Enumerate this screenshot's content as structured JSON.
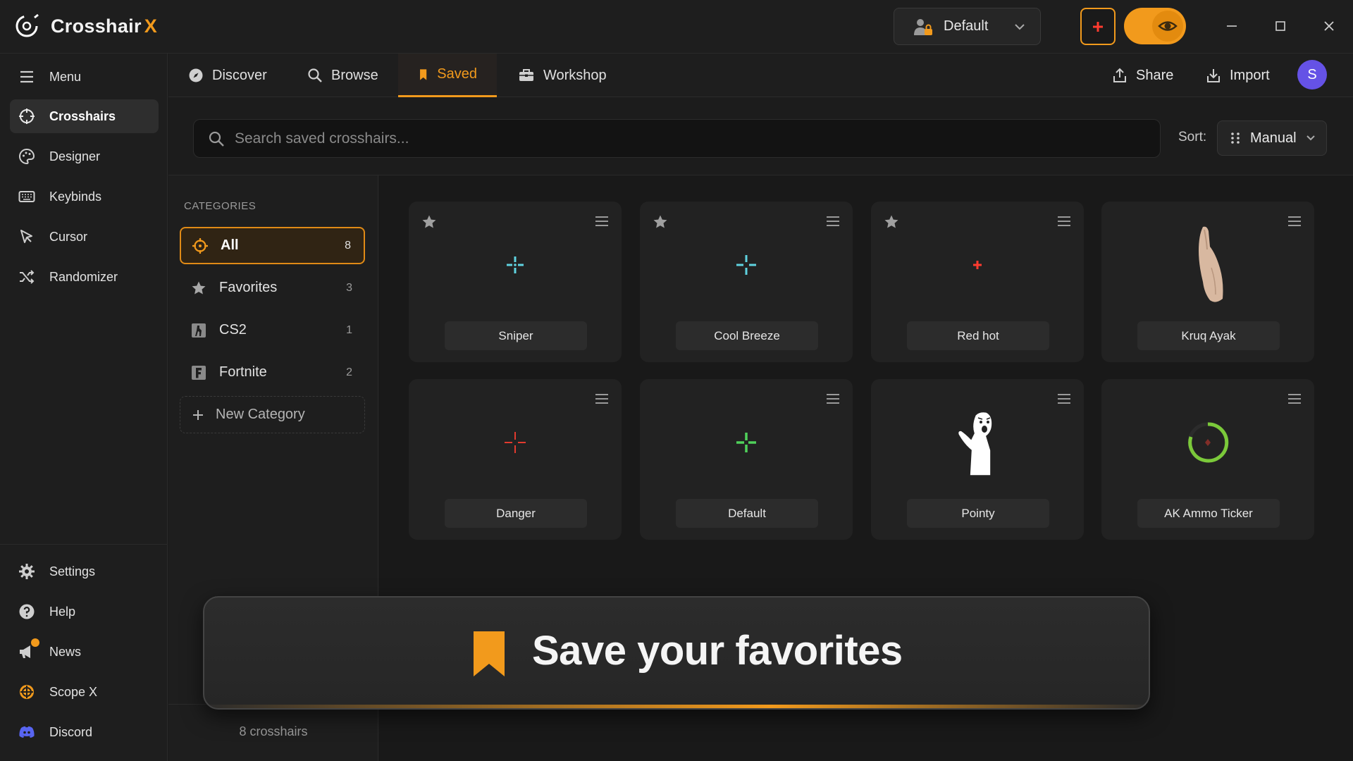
{
  "app": {
    "name": "Crosshair",
    "name_accent": "X",
    "accent_color": "#f29a1c"
  },
  "titlebar": {
    "profile_label": "Default",
    "window_controls": [
      "minimize-icon",
      "maximize-icon",
      "close-icon"
    ]
  },
  "sidebar": {
    "menu_label": "Menu",
    "items": [
      {
        "label": "Crosshairs",
        "icon": "crosshair-icon",
        "active": true
      },
      {
        "label": "Designer",
        "icon": "palette-icon"
      },
      {
        "label": "Keybinds",
        "icon": "keyboard-icon"
      },
      {
        "label": "Cursor",
        "icon": "cursor-icon"
      },
      {
        "label": "Randomizer",
        "icon": "shuffle-icon"
      }
    ],
    "bottom_items": [
      {
        "label": "Settings",
        "icon": "gear-icon"
      },
      {
        "label": "Help",
        "icon": "help-icon"
      },
      {
        "label": "News",
        "icon": "megaphone-icon"
      },
      {
        "label": "Scope X",
        "icon": "scope-icon"
      },
      {
        "label": "Discord",
        "icon": "discord-icon"
      }
    ]
  },
  "tabs": [
    {
      "label": "Discover",
      "icon": "compass-icon"
    },
    {
      "label": "Browse",
      "icon": "search-icon"
    },
    {
      "label": "Saved",
      "icon": "bookmark-icon",
      "active": true
    },
    {
      "label": "Workshop",
      "icon": "toolbox-icon"
    }
  ],
  "actions": {
    "share_label": "Share",
    "import_label": "Import",
    "avatar_initial": "S"
  },
  "search": {
    "placeholder": "Search saved crosshairs..."
  },
  "sort": {
    "label": "Sort:",
    "value": "Manual"
  },
  "categories": {
    "header": "CATEGORIES",
    "items": [
      {
        "label": "All",
        "count": "8",
        "icon": "crosshair-icon",
        "active": true
      },
      {
        "label": "Favorites",
        "count": "3",
        "icon": "star-icon"
      },
      {
        "label": "CS2",
        "count": "1",
        "icon": "cs2-icon"
      },
      {
        "label": "Fortnite",
        "count": "2",
        "icon": "fortnite-icon"
      }
    ],
    "new_label": "New Category",
    "footer": "8 crosshairs"
  },
  "crosshairs": [
    {
      "name": "Sniper",
      "favorite": true,
      "preview": "cyan-dotted-cross",
      "color": "#5fd3e0"
    },
    {
      "name": "Cool Breeze",
      "favorite": true,
      "preview": "cyan-gap-cross",
      "color": "#5fd3e0"
    },
    {
      "name": "Red hot",
      "favorite": true,
      "preview": "red-plus",
      "color": "#ff3b2f"
    },
    {
      "name": "Kruq Ayak",
      "favorite": false,
      "preview": "hand-image",
      "color": "#d8b8a0"
    },
    {
      "name": "Danger",
      "favorite": false,
      "preview": "red-thin-cross",
      "color": "#e23a2e"
    },
    {
      "name": "Default",
      "favorite": false,
      "preview": "green-cross",
      "color": "#4fd15a"
    },
    {
      "name": "Pointy",
      "favorite": false,
      "preview": "pointing-meme",
      "color": "#ffffff"
    },
    {
      "name": "AK Ammo Ticker",
      "favorite": false,
      "preview": "green-ring",
      "color": "#7bc93a"
    }
  ],
  "toast": {
    "message": "Save your favorites",
    "icon": "bookmark-icon"
  }
}
